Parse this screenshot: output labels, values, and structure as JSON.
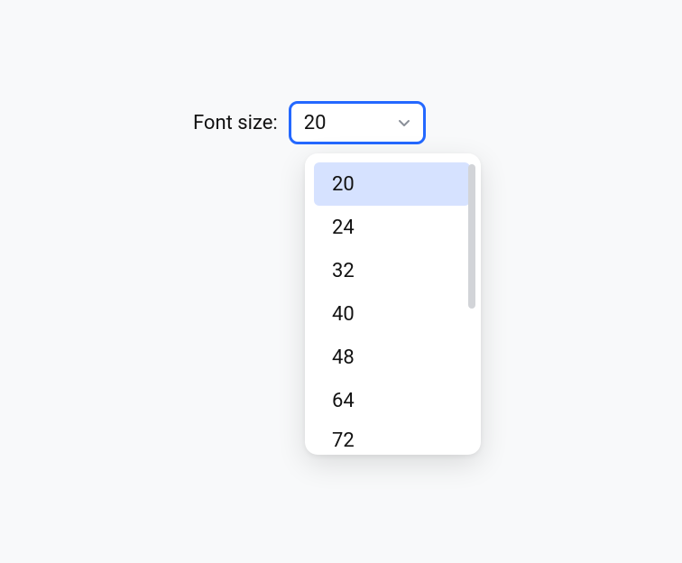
{
  "label": "Font size:",
  "selected_value": "20",
  "options": [
    "20",
    "24",
    "32",
    "40",
    "48",
    "64",
    "72"
  ],
  "selected_index": 0
}
